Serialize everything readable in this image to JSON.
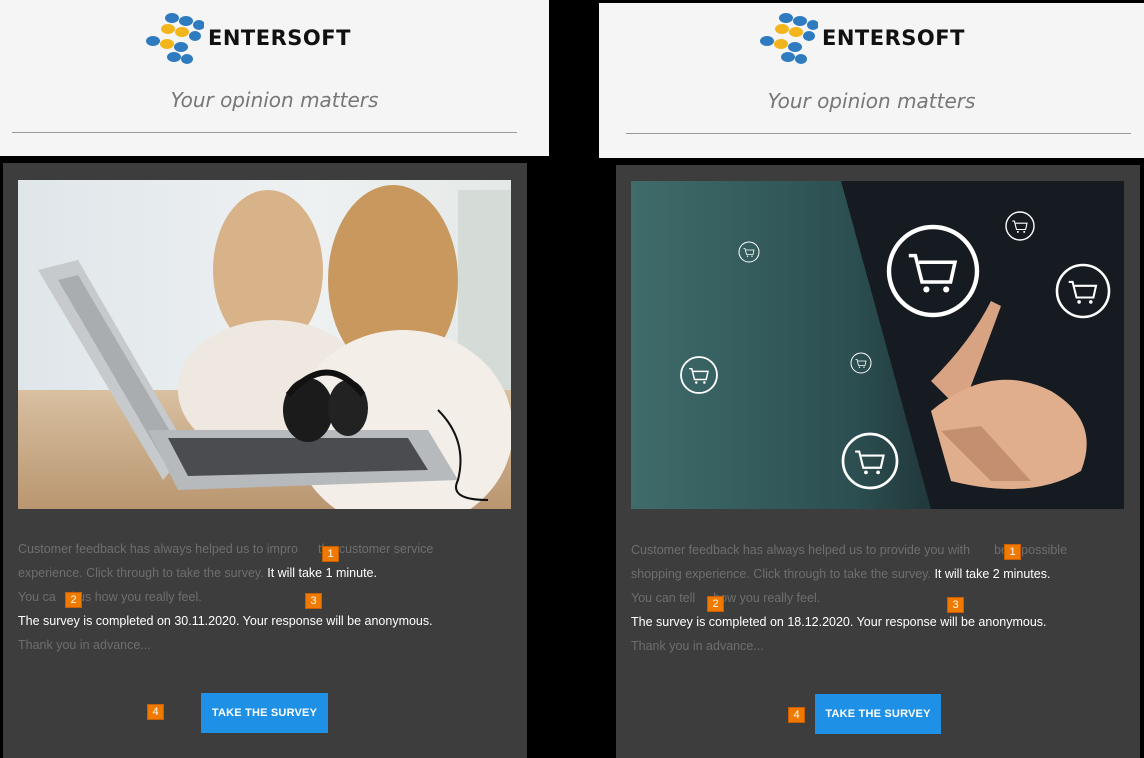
{
  "panels": [
    {
      "brand": "ENTERSOFT",
      "tagline": "Your opinion matters",
      "image_alt": "Customer support agents with headset and laptop",
      "lines": {
        "l1_a": "Customer feedback has always helped us to impro",
        "l1_b": "the customer service",
        "l2_a": "experience. Click through to take the survey.",
        "l2_b": "It will take 1 minute.",
        "l3_a": "You ca",
        "l3_b": "l us how you really feel.",
        "l4": "The survey is completed on 30.11.2020. Your response will be anonymous.",
        "l5": "Thank you in advance..."
      },
      "button_label": "TAKE THE SURVEY",
      "markers": [
        "1",
        "2",
        "3",
        "4"
      ]
    },
    {
      "brand": "ENTERSOFT",
      "tagline": "Your opinion matters",
      "image_alt": "Hand touching shopping cart icons",
      "lines": {
        "l1_a": "Customer feedback has always helped us to provide you with",
        "l1_b": "best possible",
        "l2_a": "shopping experience. Click through to take the survey.",
        "l2_b": "It will take 2 minutes.",
        "l3_a": "You can tell",
        "l3_b": "how you really feel.",
        "l4": "The survey is completed on 18.12.2020. Your response will be anonymous.",
        "l5": "Thank you in advance..."
      },
      "button_label": "TAKE THE SURVEY",
      "markers": [
        "1",
        "2",
        "3",
        "4"
      ]
    }
  ],
  "colors": {
    "header_bg": "#f5f5f5",
    "card_bg": "#3d3d3d",
    "button": "#1e90e6",
    "marker": "#f07a00",
    "muted_text": "#6e6e6e"
  }
}
